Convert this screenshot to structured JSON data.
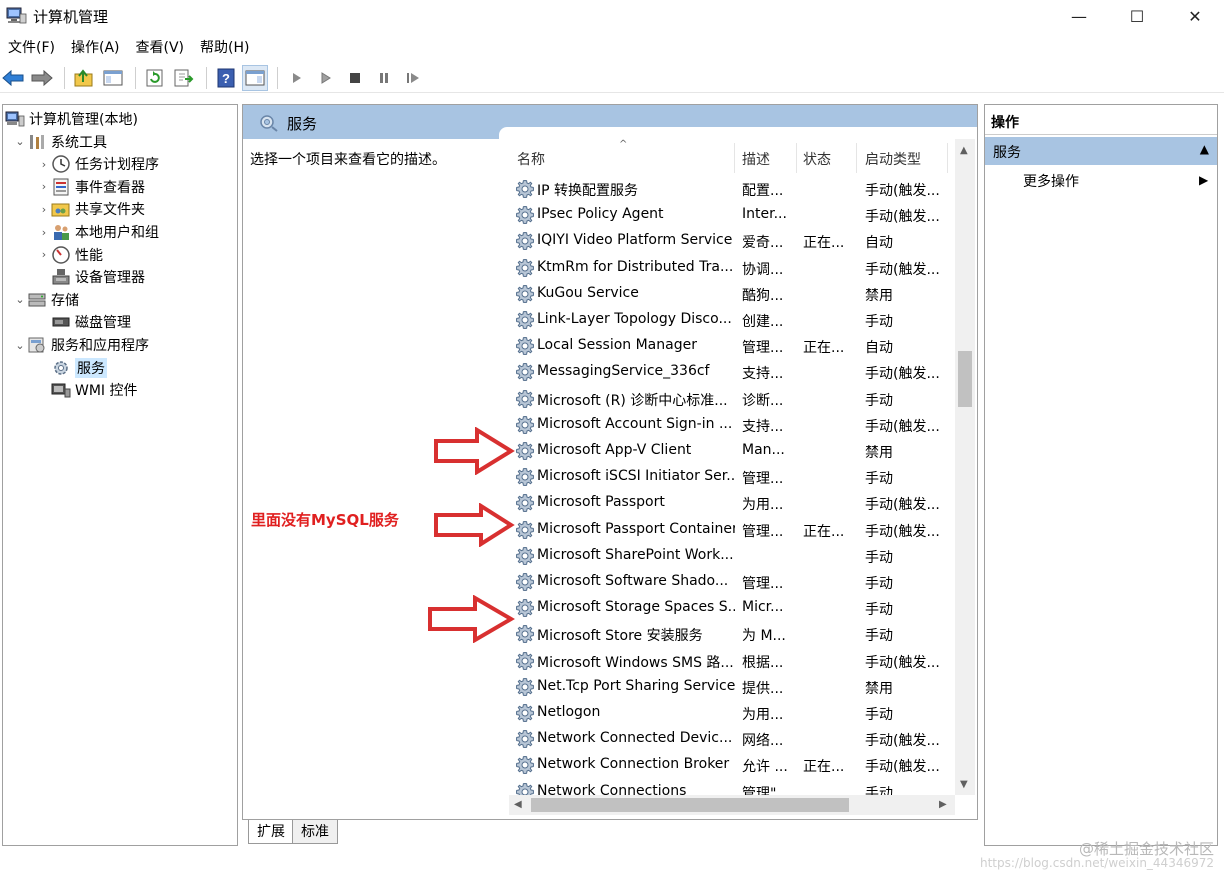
{
  "window": {
    "title": "计算机管理",
    "min": "—",
    "max": "☐",
    "close": "✕"
  },
  "menu": [
    "文件(F)",
    "操作(A)",
    "查看(V)",
    "帮助(H)"
  ],
  "tree": [
    {
      "label": "计算机管理(本地)",
      "level": 0,
      "twisty": "",
      "icon": "computer-mgmt-icon"
    },
    {
      "label": "系统工具",
      "level": 1,
      "twisty": "⌄",
      "icon": "tools-icon"
    },
    {
      "label": "任务计划程序",
      "level": 2,
      "twisty": "›",
      "icon": "clock-icon"
    },
    {
      "label": "事件查看器",
      "level": 2,
      "twisty": "›",
      "icon": "event-viewer-icon"
    },
    {
      "label": "共享文件夹",
      "level": 2,
      "twisty": "›",
      "icon": "shared-folder-icon"
    },
    {
      "label": "本地用户和组",
      "level": 2,
      "twisty": "›",
      "icon": "users-icon"
    },
    {
      "label": "性能",
      "level": 2,
      "twisty": "›",
      "icon": "performance-icon"
    },
    {
      "label": "设备管理器",
      "level": 2,
      "twisty": "",
      "icon": "device-manager-icon"
    },
    {
      "label": "存储",
      "level": 1,
      "twisty": "⌄",
      "icon": "storage-icon"
    },
    {
      "label": "磁盘管理",
      "level": 2,
      "twisty": "",
      "icon": "disk-icon"
    },
    {
      "label": "服务和应用程序",
      "level": 1,
      "twisty": "⌄",
      "icon": "services-apps-icon"
    },
    {
      "label": "服务",
      "level": 2,
      "twisty": "",
      "icon": "gear-icon",
      "selected": true
    },
    {
      "label": "WMI 控件",
      "level": 2,
      "twisty": "",
      "icon": "wmi-icon"
    }
  ],
  "center": {
    "title": "服务",
    "description": "选择一个项目来查看它的描述。",
    "annotation": "里面没有MySQL服务",
    "columns": {
      "name": "名称",
      "desc": "描述",
      "status": "状态",
      "type": "启动类型"
    },
    "sort_indicator": "^",
    "services": [
      {
        "name": "IP 转换配置服务",
        "desc": "配置...",
        "status": "",
        "type": "手动(触发..."
      },
      {
        "name": "IPsec Policy Agent",
        "desc": "Inter...",
        "status": "",
        "type": "手动(触发..."
      },
      {
        "name": "IQIYI Video Platform Service",
        "desc": "爱奇...",
        "status": "正在...",
        "type": "自动"
      },
      {
        "name": "KtmRm for Distributed Tra...",
        "desc": "协调...",
        "status": "",
        "type": "手动(触发..."
      },
      {
        "name": "KuGou Service",
        "desc": "酷狗...",
        "status": "",
        "type": "禁用"
      },
      {
        "name": "Link-Layer Topology Disco...",
        "desc": "创建...",
        "status": "",
        "type": "手动"
      },
      {
        "name": "Local Session Manager",
        "desc": "管理...",
        "status": "正在...",
        "type": "自动"
      },
      {
        "name": "MessagingService_336cf",
        "desc": "支持...",
        "status": "",
        "type": "手动(触发..."
      },
      {
        "name": "Microsoft (R) 诊断中心标准...",
        "desc": "诊断...",
        "status": "",
        "type": "手动"
      },
      {
        "name": "Microsoft Account Sign-in ...",
        "desc": "支持...",
        "status": "",
        "type": "手动(触发..."
      },
      {
        "name": "Microsoft App-V Client",
        "desc": "Man...",
        "status": "",
        "type": "禁用"
      },
      {
        "name": "Microsoft iSCSI Initiator Ser...",
        "desc": "管理...",
        "status": "",
        "type": "手动"
      },
      {
        "name": "Microsoft Passport",
        "desc": "为用...",
        "status": "",
        "type": "手动(触发..."
      },
      {
        "name": "Microsoft Passport Container",
        "desc": "管理...",
        "status": "正在...",
        "type": "手动(触发..."
      },
      {
        "name": "Microsoft SharePoint Work...",
        "desc": "",
        "status": "",
        "type": "手动"
      },
      {
        "name": "Microsoft Software Shado...",
        "desc": "管理...",
        "status": "",
        "type": "手动"
      },
      {
        "name": "Microsoft Storage Spaces S...",
        "desc": "Micr...",
        "status": "",
        "type": "手动"
      },
      {
        "name": "Microsoft Store 安装服务",
        "desc": "为 M...",
        "status": "",
        "type": "手动"
      },
      {
        "name": "Microsoft Windows SMS 路...",
        "desc": "根据...",
        "status": "",
        "type": "手动(触发..."
      },
      {
        "name": "Net.Tcp Port Sharing Service",
        "desc": "提供...",
        "status": "",
        "type": "禁用"
      },
      {
        "name": "Netlogon",
        "desc": "为用...",
        "status": "",
        "type": "手动"
      },
      {
        "name": "Network Connected Devic...",
        "desc": "网络...",
        "status": "",
        "type": "手动(触发..."
      },
      {
        "name": "Network Connection Broker",
        "desc": "允许 ...",
        "status": "正在...",
        "type": "手动(触发..."
      },
      {
        "name": "Network Connections",
        "desc": "管理\"...",
        "status": "",
        "type": "手动"
      }
    ]
  },
  "tabs": [
    "扩展",
    "标准"
  ],
  "actions": {
    "header": "操作",
    "section": "服务",
    "item": "更多操作"
  },
  "watermark": "@稀土掘金技术社区",
  "watermark_url": "https://blog.csdn.net/weixin_44346972",
  "colors": {
    "header_blue": "#a8c4e2",
    "selection": "#cce8ff",
    "annotation_red": "#e02020"
  }
}
